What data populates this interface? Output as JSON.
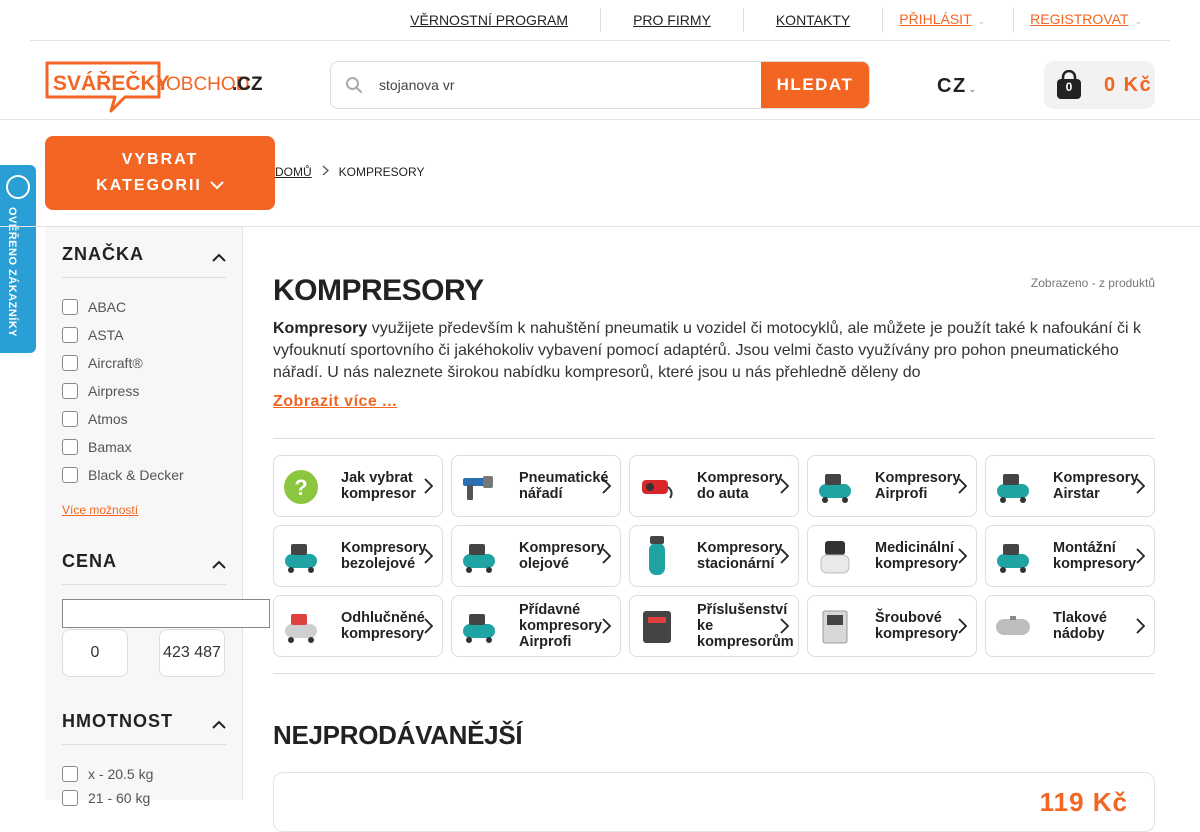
{
  "topnav": {
    "items": [
      "VĚRNOSTNÍ PROGRAM",
      "PRO FIRMY",
      "KONTAKTY"
    ],
    "login": "PŘIHLÁSIT",
    "register": "REGISTROVAT"
  },
  "logo": {
    "brand": "SVÁŘEČKY",
    "rest": "OBCHOD",
    "tld": ".CZ"
  },
  "search": {
    "value": "stojanova vr",
    "button": "HLEDAT"
  },
  "lang": "CZ",
  "cart": {
    "count": "0",
    "price": "0 Kč"
  },
  "category_button": {
    "line1": "VYBRAT",
    "line2": "KATEGORII"
  },
  "breadcrumb": {
    "home": "DOMŮ",
    "current": "KOMPRESORY"
  },
  "verified_badge": "OVĚŘENO ZÁKAZNÍKY",
  "filters": {
    "brand": {
      "title": "ZNAČKA",
      "items": [
        "ABAC",
        "ASTA",
        "Aircraft®",
        "Airpress",
        "Atmos",
        "Bamax",
        "Black & Decker"
      ],
      "more": "Více možností"
    },
    "price": {
      "title": "CENA",
      "min": "0",
      "max": "423 487"
    },
    "weight": {
      "title": "HMOTNOST",
      "items": [
        "x - 20.5 kg",
        "21 - 60 kg"
      ]
    }
  },
  "main": {
    "title": "KOMPRESORY",
    "count": "Zobrazeno - z produktů",
    "desc_bold": "Kompresory",
    "desc_rest": " využijete především k nahuštění pneumatik u vozidel či motocyklů, ale můžete je použít také k nafoukání či k vyfouknutí sportovního či jakéhokoliv vybavení pomocí adaptérů. Jsou velmi často využívány pro pohon pneumatického nářadí. U nás naleznete širokou nabídku kompresorů, které jsou u nás přehledně děleny do",
    "show_more": "Zobrazit více ...",
    "bestsellers": "NEJPRODÁVANĚJŠÍ",
    "card_price": "119 Kč"
  },
  "categories": [
    {
      "l1": "Jak vybrat",
      "l2": "kompresor",
      "l3": "",
      "icon": "question-icon"
    },
    {
      "l1": "Pneumatické",
      "l2": "nářadí",
      "l3": "",
      "icon": "nailer-icon"
    },
    {
      "l1": "Kompresory",
      "l2": "do auta",
      "l3": "",
      "icon": "car-compressor-icon"
    },
    {
      "l1": "Kompresory",
      "l2": "Airprofi",
      "l3": "",
      "icon": "compressor-icon"
    },
    {
      "l1": "Kompresory",
      "l2": "Airstar",
      "l3": "",
      "icon": "compressor-icon"
    },
    {
      "l1": "Kompresory",
      "l2": "bezolejové",
      "l3": "",
      "icon": "compressor-icon"
    },
    {
      "l1": "Kompresory",
      "l2": "olejové",
      "l3": "",
      "icon": "compressor-icon"
    },
    {
      "l1": "Kompresory",
      "l2": "stacionární",
      "l3": "",
      "icon": "vertical-tank-icon"
    },
    {
      "l1": "Medicinální",
      "l2": "kompresory",
      "l3": "",
      "icon": "medical-compressor-icon"
    },
    {
      "l1": "Montážní",
      "l2": "kompresory",
      "l3": "",
      "icon": "compressor-icon"
    },
    {
      "l1": "Odhlučněné",
      "l2": "kompresory",
      "l3": "",
      "icon": "silent-compressor-icon"
    },
    {
      "l1": "Přídavné",
      "l2": "kompresory",
      "l3": "Airprofi",
      "icon": "compressor-icon"
    },
    {
      "l1": "Příslušenství",
      "l2": "ke",
      "l3": "kompresorům",
      "icon": "accessory-icon"
    },
    {
      "l1": "Šroubové",
      "l2": "kompresory",
      "l3": "",
      "icon": "screw-compressor-icon"
    },
    {
      "l1": "Tlakové",
      "l2": "nádoby",
      "l3": "",
      "icon": "tank-icon"
    }
  ],
  "colors": {
    "accent": "#f26522",
    "badge": "#2a9fd6",
    "tile_teal": "#1fa3a3"
  }
}
